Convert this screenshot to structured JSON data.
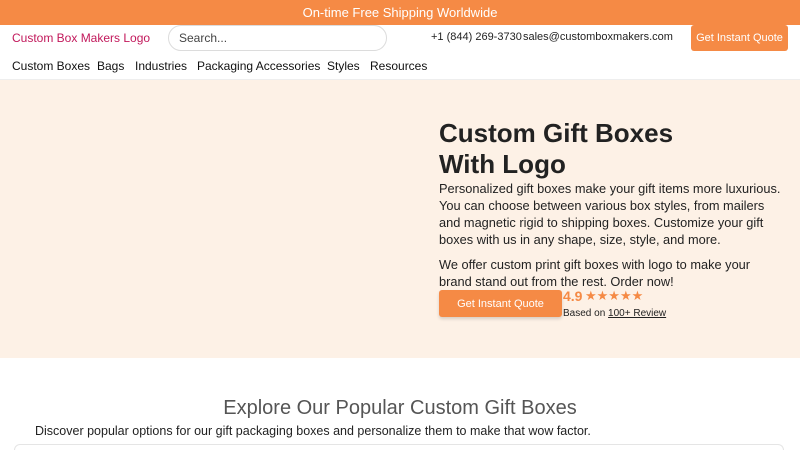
{
  "topbar": {
    "text": "On-time Free Shipping Worldwide"
  },
  "header": {
    "logo": "Custom Box Makers Logo",
    "search_placeholder": "Search...",
    "phone": "+1 (844) 269-3730",
    "email": "sales@customboxmakers.com",
    "quote_button": "Get Instant Quote"
  },
  "nav": {
    "items": [
      "Custom Boxes",
      "Bags",
      "Industries",
      "Packaging Accessories",
      "Styles",
      "Resources"
    ]
  },
  "hero": {
    "title_line1": "Custom Gift Boxes",
    "title_line2": "With Logo",
    "description": "Personalized gift boxes make your gift items more luxurious. You can choose between various box styles, from mailers and magnetic rigid to shipping boxes. Customize your gift boxes with us in any shape, size, style, and more.",
    "description2": "We offer custom print gift boxes with logo to make your brand stand out from the rest. Order now!",
    "quote_button": "Get Instant Quote",
    "rating": "4.9",
    "stars": "★★★★★",
    "based_on": "Based on",
    "review_link": "100+ Review"
  },
  "section": {
    "title": "Explore Our Popular Custom Gift Boxes",
    "subtitle": "Discover popular options for our gift packaging boxes and personalize them to make that wow factor."
  },
  "colors": {
    "accent": "#f58a45",
    "hero_bg": "#fdf1e6",
    "logo_text": "#c2185b"
  }
}
